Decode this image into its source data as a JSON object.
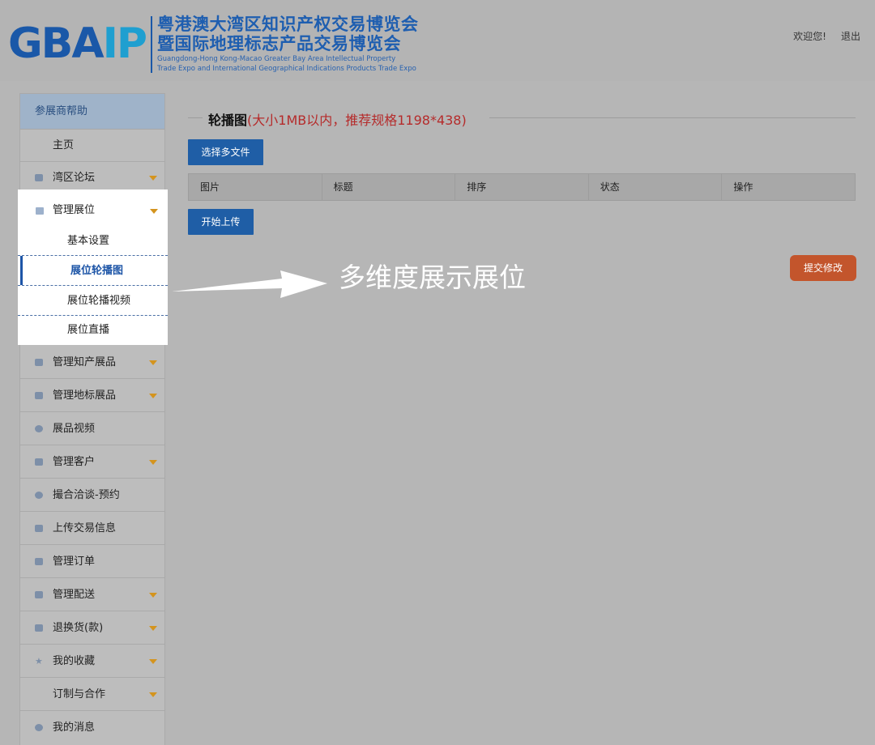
{
  "header": {
    "logo_mark": "GBA",
    "logo_mark_ip": "IP",
    "title_cn_1": "粤港澳大湾区知识产权交易博览会",
    "title_cn_2": "暨国际地理标志产品交易博览会",
    "title_en_1": "Guangdong-Hong Kong-Macao Greater Bay Area Intellectual Property",
    "title_en_2": "Trade Expo and International Geographical Indications Products Trade Expo",
    "welcome": "欢迎您!",
    "logout": "退出"
  },
  "sidebar": {
    "head": "参展商帮助",
    "items": [
      {
        "label": "主页",
        "icon": "none"
      },
      {
        "label": "湾区论坛",
        "icon": "chat-icon",
        "caret": true
      },
      {
        "label": "管理展位",
        "icon": "booth-icon",
        "caret": true
      },
      {
        "label": "基本设置"
      },
      {
        "label": "展位轮播图"
      },
      {
        "label": "展位轮播视频"
      },
      {
        "label": "展位直播"
      },
      {
        "label": "管理知产展品",
        "icon": "grid-icon",
        "caret": true
      },
      {
        "label": "管理地标展品",
        "icon": "grid-icon",
        "caret": true
      },
      {
        "label": "展品视频",
        "icon": "video-icon"
      },
      {
        "label": "管理客户",
        "icon": "user-icon",
        "caret": true
      },
      {
        "label": "撮合洽谈-预约",
        "icon": "circle-icon"
      },
      {
        "label": "上传交易信息",
        "icon": "document-icon"
      },
      {
        "label": "管理订单",
        "icon": "list-icon"
      },
      {
        "label": "管理配送",
        "icon": "truck-icon",
        "caret": true
      },
      {
        "label": "退换货(款)",
        "icon": "return-icon",
        "caret": true
      },
      {
        "label": "我的收藏",
        "icon": "star-icon",
        "caret": true
      },
      {
        "label": "订制与合作",
        "caret": true
      },
      {
        "label": "我的消息",
        "icon": "message-icon"
      }
    ]
  },
  "main": {
    "title": "轮播图",
    "title_note": "(大小1MB以内，推荐规格1198*438)",
    "select_files": "选择多文件",
    "columns": [
      "图片",
      "标题",
      "排序",
      "状态",
      "操作"
    ],
    "start_upload": "开始上传",
    "submit": "提交修改"
  },
  "annotation": "多维度展示展位",
  "colors": {
    "accent": "#1f5ea6",
    "submit": "#c3552c",
    "caret": "#d4941e",
    "note": "#b52b2b"
  }
}
